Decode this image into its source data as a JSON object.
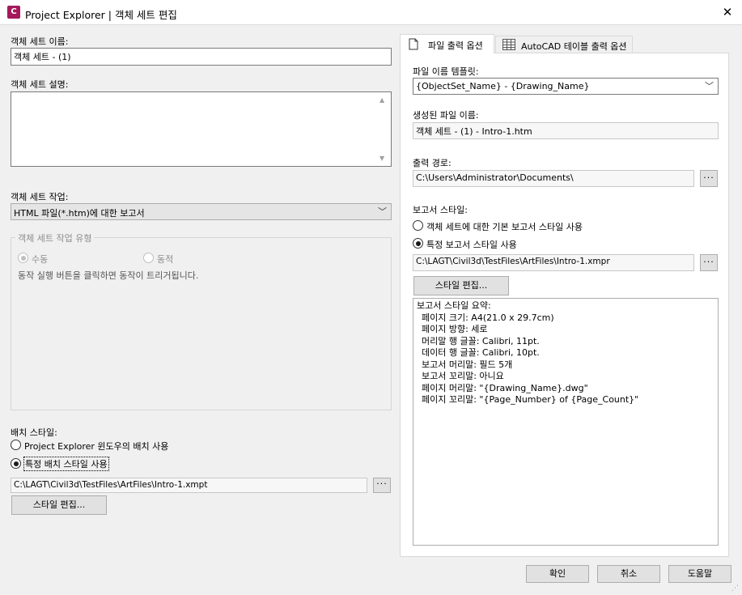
{
  "window": {
    "title": "Project Explorer | 객체 세트 편집",
    "app_icon_text": "C"
  },
  "left": {
    "name_label": "객체 세트 이름:",
    "name_value": "객체 세트 - (1)",
    "desc_label": "객체 세트 설명:",
    "desc_value": "",
    "action_label": "객체 세트 작업:",
    "action_value": "HTML 파일(*.htm)에 대한 보고서",
    "action_type_group": "객체 세트 작업 유형",
    "manual_label": "수동",
    "auto_label": "동적",
    "action_hint": "동작 실행 버튼을 클릭하면 동작이 트리거됩니다.",
    "layout_label": "배치 스타일:",
    "layout_opt1": "Project Explorer 윈도우의 배치 사용",
    "layout_opt2": "특정 배치 스타일 사용",
    "layout_path": "C:\\LAGT\\Civil3d\\TestFiles\\ArtFiles\\Intro-1.xmpt",
    "edit_style_btn": "스타일 편집..."
  },
  "tabs": [
    {
      "label": "파일 출력 옵션",
      "active": true
    },
    {
      "label": "AutoCAD 테이블 출력 옵션",
      "active": false
    }
  ],
  "right": {
    "template_label": "파일 이름 템플릿:",
    "template_value": "{ObjectSet_Name} - {Drawing_Name}",
    "generated_label": "생성된 파일 이름:",
    "generated_value": "객체 세트 - (1) - Intro-1.htm",
    "output_label": "출력 경로:",
    "output_value": "C:\\Users\\Administrator\\Documents\\",
    "report_style_label": "보고서 스타일:",
    "report_opt1": "객체 세트에 대한 기본 보고서 스타일 사용",
    "report_opt2": "특정 보고서 스타일 사용",
    "report_path": "C:\\LAGT\\Civil3d\\TestFiles\\ArtFiles\\Intro-1.xmpr",
    "edit_style_btn": "스타일 편집...",
    "summary": [
      "보고서 스타일 요약:",
      "  페이지 크기: A4(21.0 x 29.7cm)",
      "  페이지 방향: 세로",
      "  머리말 행 글꼴: Calibri, 11pt.",
      "  데이터 행 글꼴: Calibri, 10pt.",
      "  보고서 머리말: 필드 5개",
      "  보고서 꼬리말: 아니요",
      "  페이지 머리말: \"{Drawing_Name}.dwg\"",
      "  페이지 꼬리말: \"{Page_Number} of {Page_Count}\""
    ]
  },
  "buttons": {
    "ok": "확인",
    "cancel": "취소",
    "help": "도움말",
    "browse": "···"
  }
}
